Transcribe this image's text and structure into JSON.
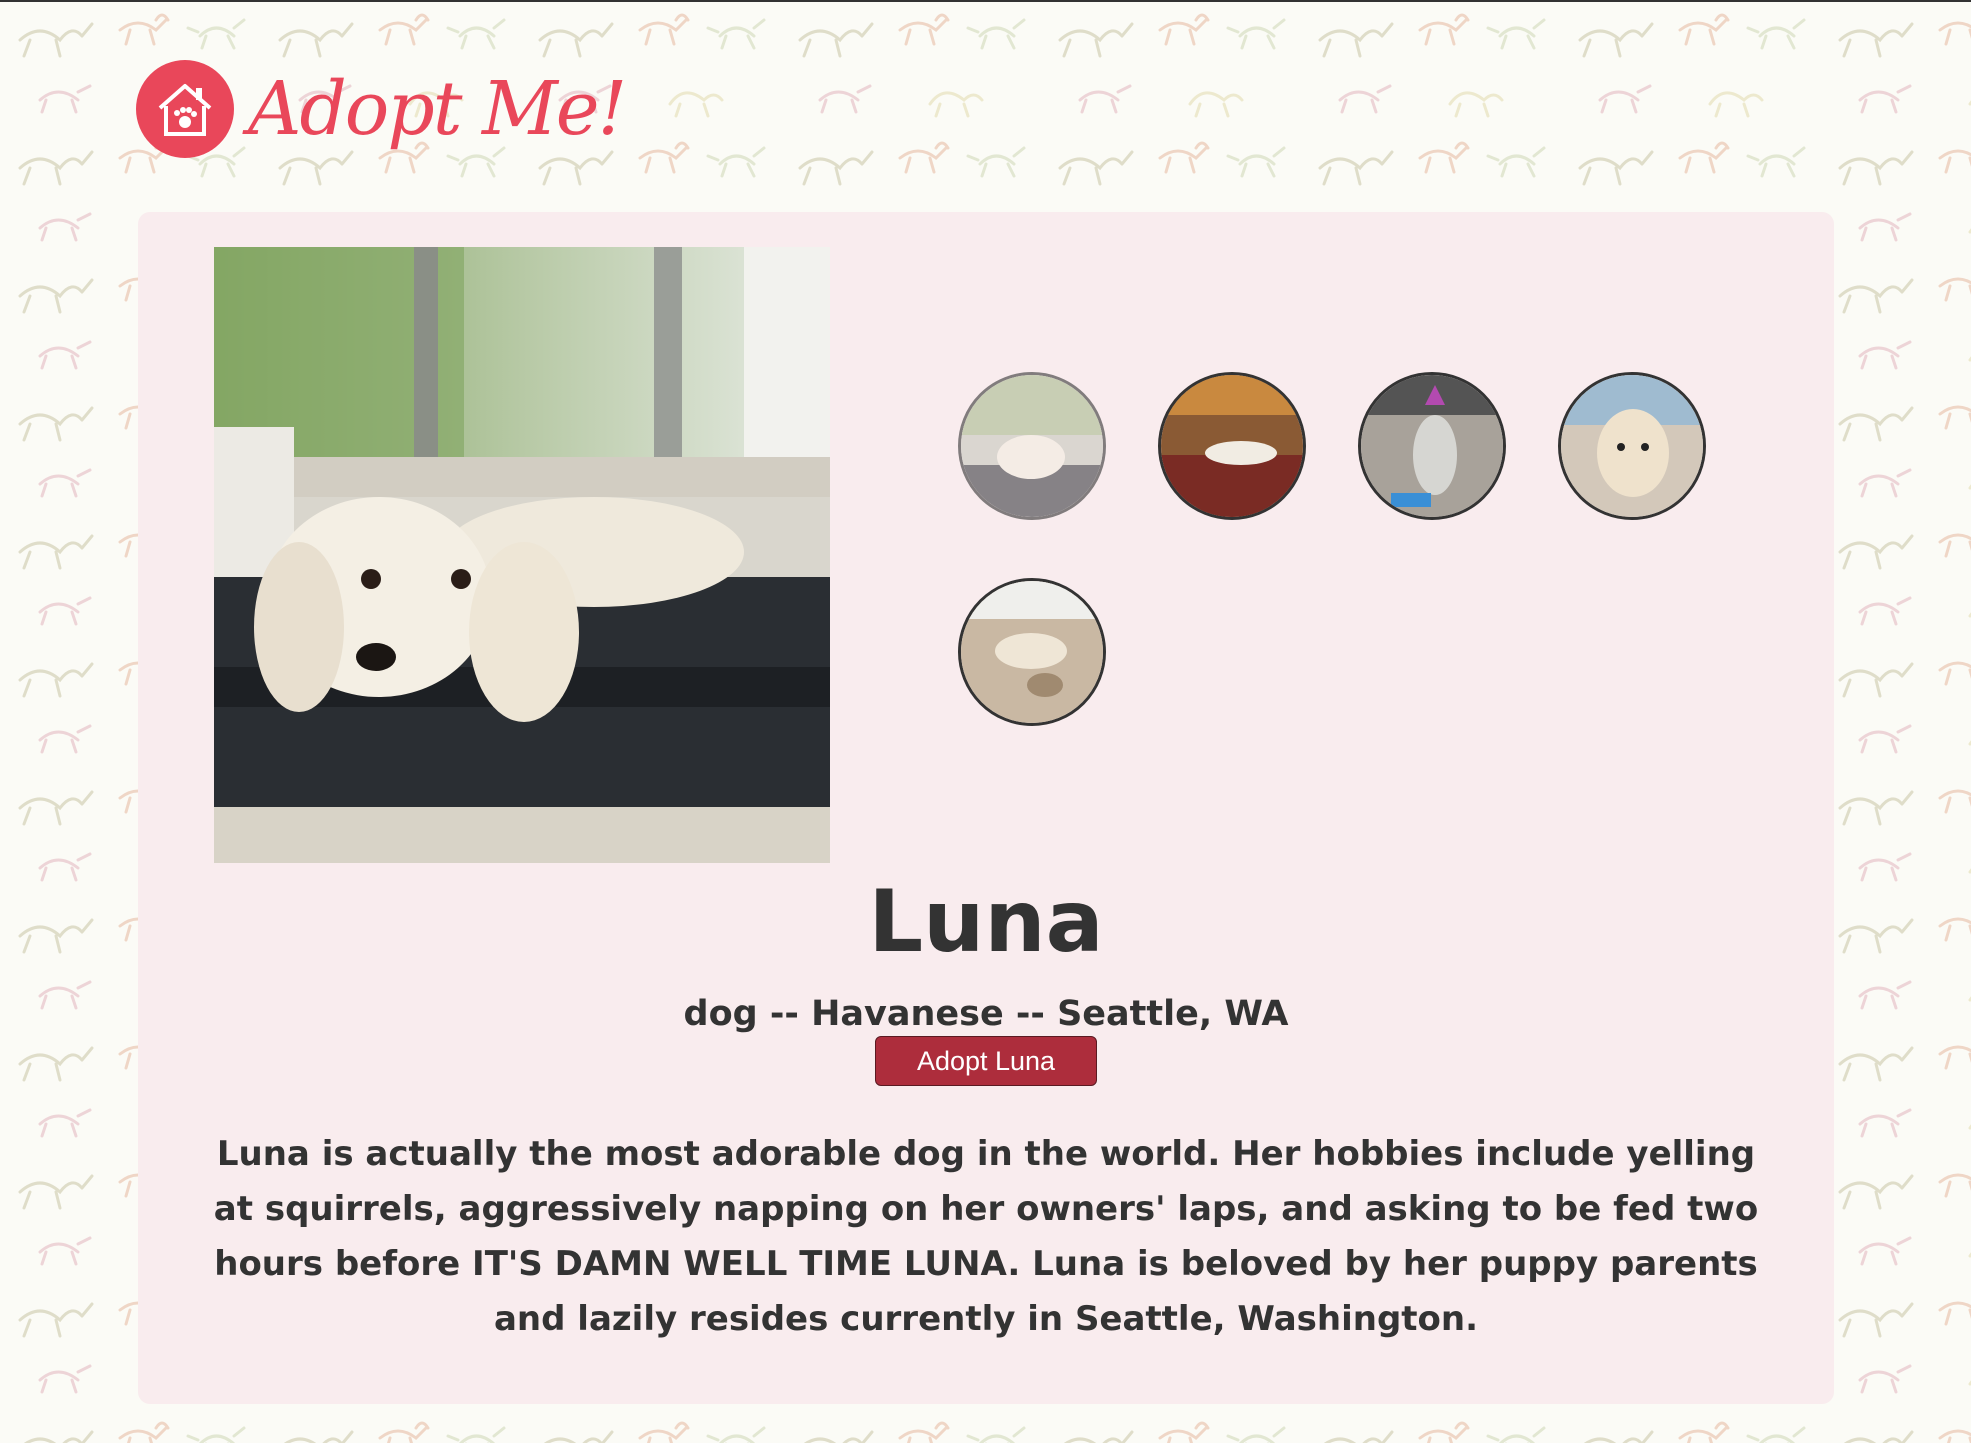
{
  "brand": {
    "name": "Adopt Me!",
    "color": "#e9475a"
  },
  "pet": {
    "name": "Luna",
    "meta": "dog -- Havanese -- Seattle, WA",
    "adopt_label": "Adopt Luna",
    "description": "Luna is actually the most adorable dog in the world. Her hobbies include yelling at squirrels, aggressively napping on her owners' laps, and asking to be fed two hours before IT'S DAMN WELL TIME LUNA. Luna is beloved by her puppy parents and lazily resides currently in Seattle, Washington."
  },
  "gallery": {
    "active_index": 0,
    "thumbnails": [
      "photo-1",
      "photo-2",
      "photo-3",
      "photo-4",
      "photo-5"
    ]
  },
  "colors": {
    "card_bg": "#f9ecee",
    "button": "#ad2d3c",
    "text": "#333333"
  }
}
